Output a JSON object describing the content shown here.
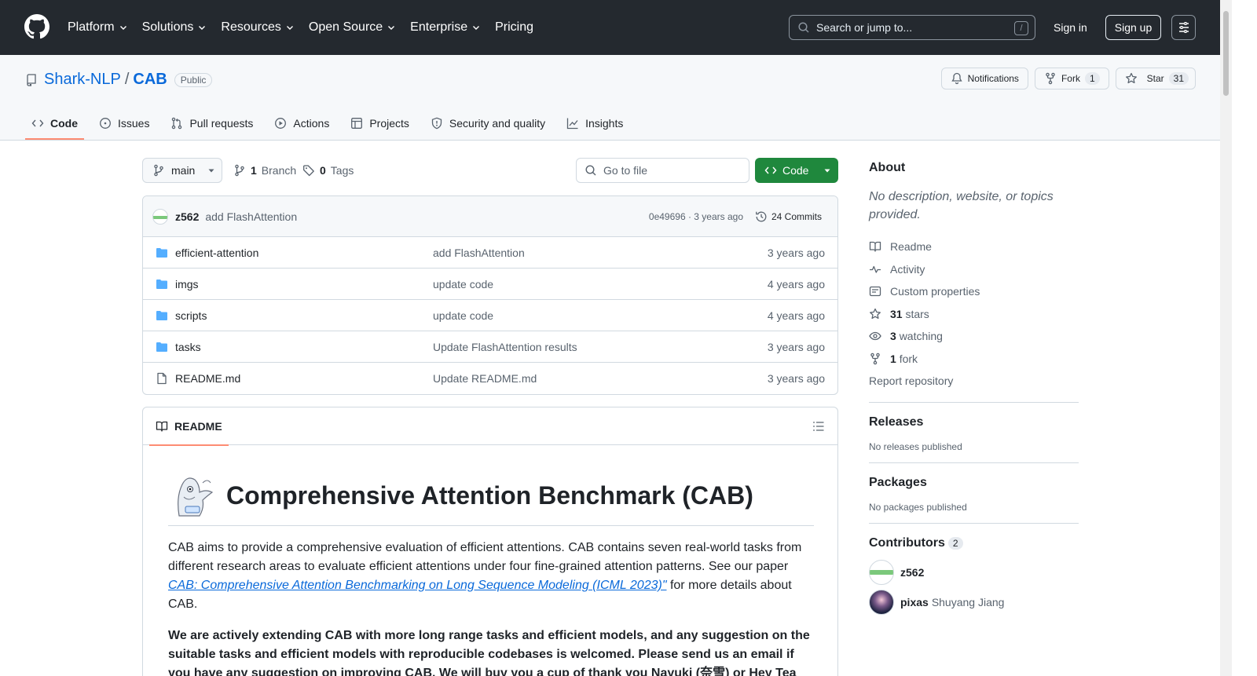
{
  "header": {
    "nav": [
      {
        "label": "Platform",
        "has_menu": true
      },
      {
        "label": "Solutions",
        "has_menu": true
      },
      {
        "label": "Resources",
        "has_menu": true
      },
      {
        "label": "Open Source",
        "has_menu": true
      },
      {
        "label": "Enterprise",
        "has_menu": true
      },
      {
        "label": "Pricing",
        "has_menu": false
      }
    ],
    "search_placeholder": "Search or jump to...",
    "search_shortcut": "/",
    "sign_in": "Sign in",
    "sign_up": "Sign up"
  },
  "repo": {
    "owner": "Shark-NLP",
    "separator": "/",
    "name": "CAB",
    "visibility": "Public",
    "notifications_label": "Notifications",
    "fork_label": "Fork",
    "fork_count": "1",
    "star_label": "Star",
    "star_count": "31",
    "tabs": [
      {
        "label": "Code",
        "icon": "code-icon",
        "active": true
      },
      {
        "label": "Issues",
        "icon": "issue-icon",
        "active": false
      },
      {
        "label": "Pull requests",
        "icon": "pull-request-icon",
        "active": false
      },
      {
        "label": "Actions",
        "icon": "play-icon",
        "active": false
      },
      {
        "label": "Projects",
        "icon": "table-icon",
        "active": false
      },
      {
        "label": "Security and quality",
        "icon": "shield-icon",
        "active": false
      },
      {
        "label": "Insights",
        "icon": "graph-icon",
        "active": false
      }
    ]
  },
  "toolbar": {
    "branch": "main",
    "branch_count": "1",
    "branch_label": "Branch",
    "tag_count": "0",
    "tag_label": "Tags",
    "go_to_file": "Go to file",
    "code_button": "Code"
  },
  "latest_commit": {
    "author": "z562",
    "message": "add FlashAttention",
    "meta": "0e49696 · 3 years ago",
    "commits_label": "24 Commits"
  },
  "files": [
    {
      "name": "efficient-attention",
      "type": "folder",
      "message": "add FlashAttention",
      "age": "3 years ago"
    },
    {
      "name": "imgs",
      "type": "folder",
      "message": "update code",
      "age": "4 years ago"
    },
    {
      "name": "scripts",
      "type": "folder",
      "message": "update code",
      "age": "4 years ago"
    },
    {
      "name": "tasks",
      "type": "folder",
      "message": "Update FlashAttention results",
      "age": "3 years ago"
    },
    {
      "name": "README.md",
      "type": "file",
      "message": "Update README.md",
      "age": "3 years ago"
    }
  ],
  "readme": {
    "tab_label": "README",
    "title": "Comprehensive Attention Benchmark (CAB)",
    "p1_before": "CAB aims to provide a comprehensive evaluation of efficient attentions. CAB contains seven real-world tasks from different research areas to evaluate efficient attentions under four fine-grained attention patterns. See our paper ",
    "p1_link": "CAB: Comprehensive Attention Benchmarking on Long Sequence Modeling (ICML 2023)\"",
    "p1_after": " for more details about CAB.",
    "p2": "We are actively extending CAB with more long range tasks and efficient models, and any suggestion on the suitable tasks and efficient models with reproducible codebases is welcomed. Please send us an email if you have any suggestion on improving CAB. We will buy you a cup of thank you Nayuki (奈雪) or Hey Tea (喜茶)"
  },
  "sidebar": {
    "about_title": "About",
    "about_desc": "No description, website, or topics provided.",
    "items": [
      {
        "icon": "book-icon",
        "bold": "",
        "label": "Readme"
      },
      {
        "icon": "pulse-icon",
        "bold": "",
        "label": "Activity"
      },
      {
        "icon": "note-icon",
        "bold": "",
        "label": "Custom properties"
      },
      {
        "icon": "star-icon",
        "bold": "31",
        "label": "stars"
      },
      {
        "icon": "eye-icon",
        "bold": "3",
        "label": "watching"
      },
      {
        "icon": "fork-icon",
        "bold": "1",
        "label": "fork"
      }
    ],
    "report": "Report repository",
    "releases_title": "Releases",
    "releases_text": "No releases published",
    "packages_title": "Packages",
    "packages_text": "No packages published",
    "contributors_title": "Contributors",
    "contributors_count": "2",
    "contributors": [
      {
        "login": "z562",
        "name": ""
      },
      {
        "login": "pixas",
        "name": "Shuyang Jiang"
      }
    ]
  }
}
